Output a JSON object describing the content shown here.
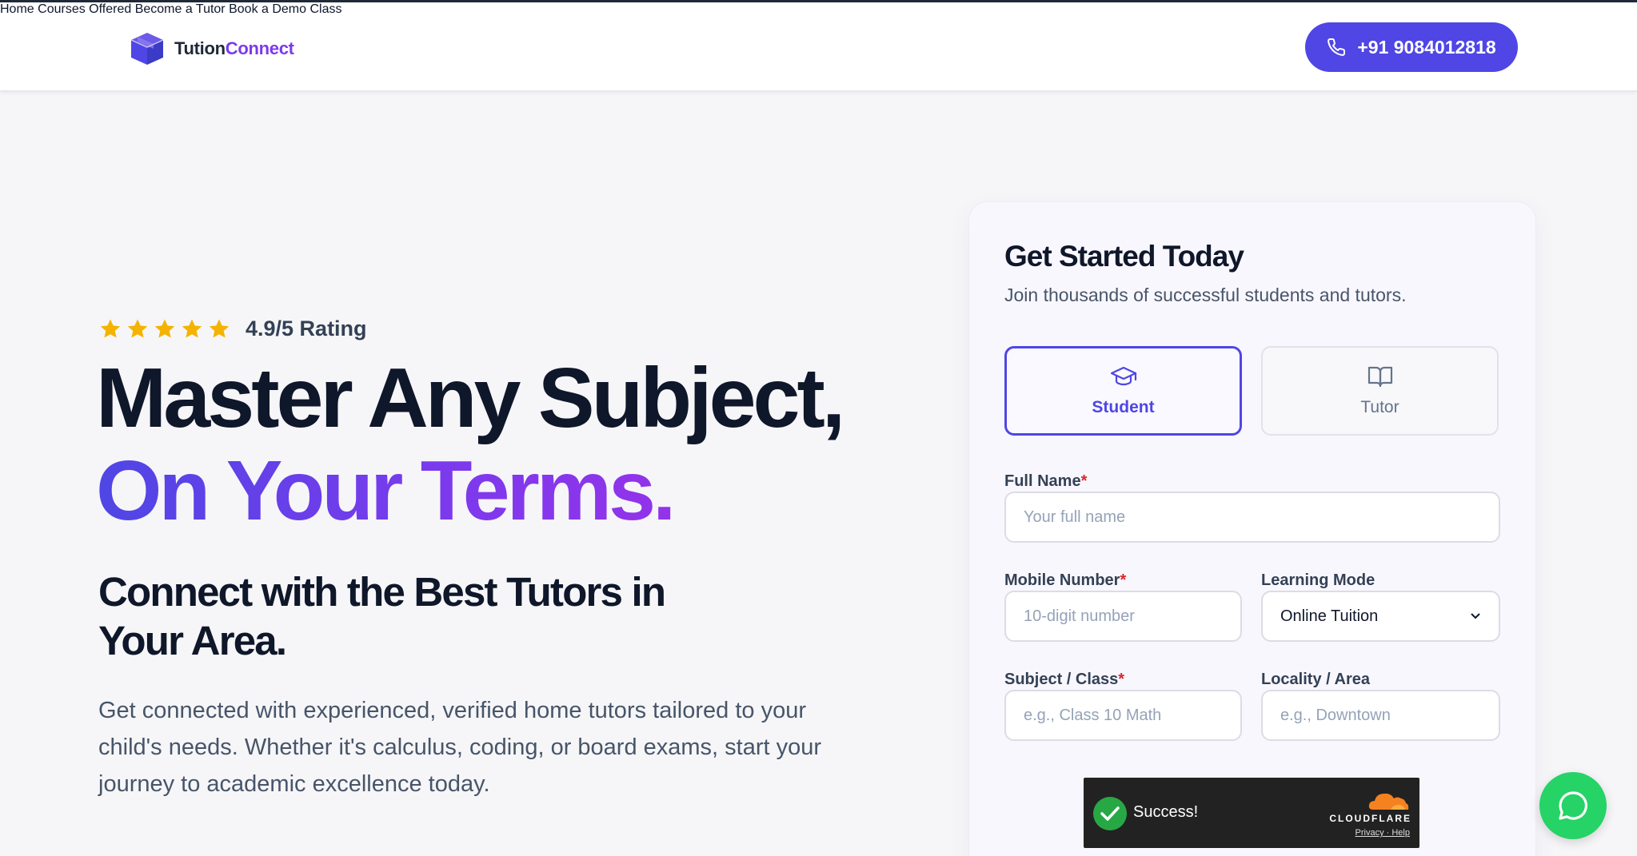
{
  "brand": {
    "name_part1": "Tution",
    "name_part2": "Connect"
  },
  "nav": {
    "items": [
      {
        "label": "Home"
      },
      {
        "label": "Courses Offered"
      },
      {
        "label": "Become a Tutor"
      },
      {
        "label": "Book a Demo Class"
      }
    ],
    "phone": "+91 9084012818"
  },
  "hero": {
    "rating_stars": 5,
    "rating_text": "4.9/5 Rating",
    "title_line1": "Master Any Subject,",
    "title_line2": "On Your Terms.",
    "subtitle": "Connect with the Best Tutors in Your Area.",
    "description": "Get connected with experienced, verified home tutors tailored to your child's needs. Whether it's calculus, coding, or board exams, start your journey to academic excellence today."
  },
  "form": {
    "title": "Get Started Today",
    "subtitle": "Join thousands of successful students and tutors.",
    "roles": [
      {
        "label": "Student",
        "icon": "graduation-cap-icon",
        "selected": true
      },
      {
        "label": "Tutor",
        "icon": "open-book-icon",
        "selected": false
      }
    ],
    "full_name": {
      "label": "Full Name",
      "placeholder": "Your full name"
    },
    "mobile": {
      "label": "Mobile Number",
      "placeholder": "10-digit number"
    },
    "learning_mode": {
      "label": "Learning Mode",
      "value": "Online Tuition"
    },
    "subject": {
      "label": "Subject / Class",
      "placeholder": "e.g., Class 10 Math"
    },
    "locality": {
      "label": "Locality / Area",
      "placeholder": "e.g., Downtown"
    },
    "required_mark": "*"
  },
  "captcha": {
    "status": "Success!",
    "provider": "CLOUDFLARE",
    "links": "Privacy · Help"
  },
  "colors": {
    "primary": "#4f46e5",
    "accent": "#7c3aed",
    "star": "#f5b301",
    "whatsapp": "#25d366"
  }
}
